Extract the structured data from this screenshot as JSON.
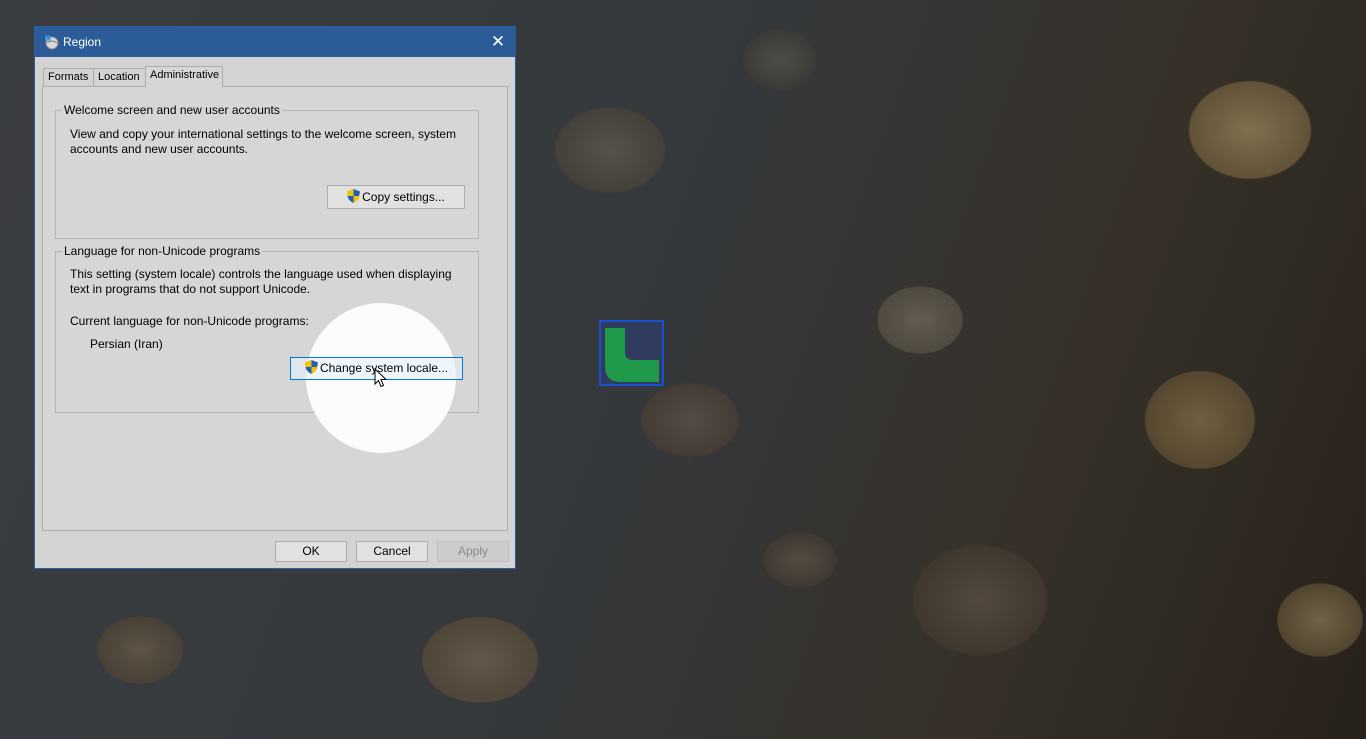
{
  "window": {
    "title": "Region",
    "close_glyph": "✕"
  },
  "tabs": [
    {
      "label": "Formats"
    },
    {
      "label": "Location"
    },
    {
      "label": "Administrative",
      "selected": true
    }
  ],
  "welcome_group": {
    "title": "Welcome screen and new user accounts",
    "description_line1": "View and copy your international settings to the welcome screen, system",
    "description_line2": "accounts and new user accounts.",
    "copy_button": "Copy settings..."
  },
  "unicode_group": {
    "title": "Language for non-Unicode programs",
    "description_line1": "This setting (system locale) controls the language used when displaying",
    "description_line2": "text in programs that do not support Unicode.",
    "current_label": "Current language for non-Unicode programs:",
    "current_value": "Persian (Iran)",
    "change_button": "Change system locale..."
  },
  "footer": {
    "ok": "OK",
    "cancel": "Cancel",
    "apply": "Apply"
  },
  "colors": {
    "titlebar": "#2b5c98",
    "dialog_bg": "#d3d3d3",
    "focus_border": "#0078d7",
    "marker_green": "#1f9a4a",
    "marker_blue": "#1a4fd0"
  },
  "icons": {
    "title_icon": "region-globe-icon",
    "shield": "uac-shield-icon",
    "cursor": "mouse-pointer-icon"
  }
}
